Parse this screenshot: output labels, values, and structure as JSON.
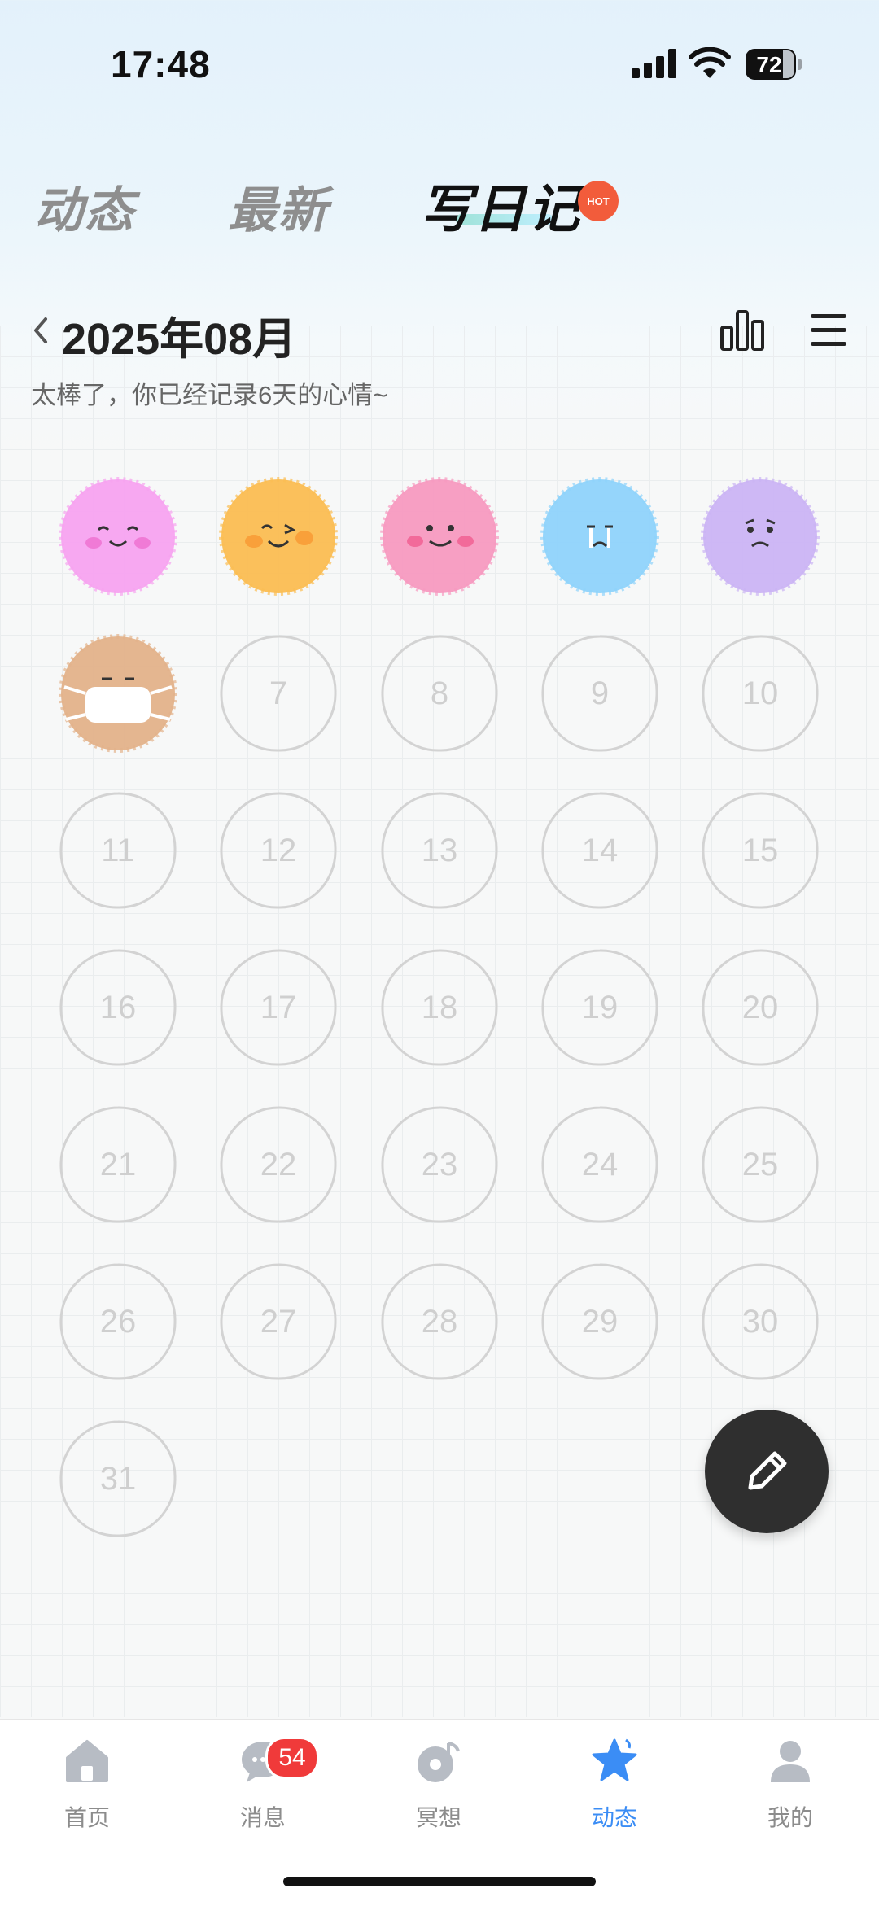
{
  "status_bar": {
    "time": "17:48",
    "battery": "72"
  },
  "tabs": [
    {
      "label": "动态"
    },
    {
      "label": "最新"
    },
    {
      "label": "写日记",
      "badge": "HOT"
    }
  ],
  "calendar": {
    "month_title": "2025年08月",
    "summary": "太棒了，你已经记录6天的心情~",
    "days": [
      "7",
      "8",
      "9",
      "10",
      "11",
      "12",
      "13",
      "14",
      "15",
      "16",
      "17",
      "18",
      "19",
      "20",
      "21",
      "22",
      "23",
      "24",
      "25",
      "26",
      "27",
      "28",
      "29",
      "30",
      "31"
    ],
    "moods": [
      {
        "day": 1,
        "mood": "happy-blush",
        "color": "#f7a3f0"
      },
      {
        "day": 2,
        "mood": "wink",
        "color": "#fbbd52"
      },
      {
        "day": 3,
        "mood": "smile",
        "color": "#f79ac0"
      },
      {
        "day": 4,
        "mood": "crying",
        "color": "#8fd3fb"
      },
      {
        "day": 5,
        "mood": "worried",
        "color": "#cbb4f4"
      },
      {
        "day": 6,
        "mood": "sick-mask",
        "color": "#e3b28a"
      }
    ]
  },
  "fab": {
    "icon": "pencil-icon"
  },
  "bottom_nav": [
    {
      "label": "首页",
      "icon": "home-icon"
    },
    {
      "label": "消息",
      "icon": "chat-icon",
      "badge": "54"
    },
    {
      "label": "冥想",
      "icon": "meditation-icon"
    },
    {
      "label": "动态",
      "icon": "star-icon",
      "active": true
    },
    {
      "label": "我的",
      "icon": "profile-icon"
    }
  ],
  "colors": {
    "accent": "#3b8df5",
    "badge": "#f03a3a",
    "fab": "#2f2f2f"
  }
}
